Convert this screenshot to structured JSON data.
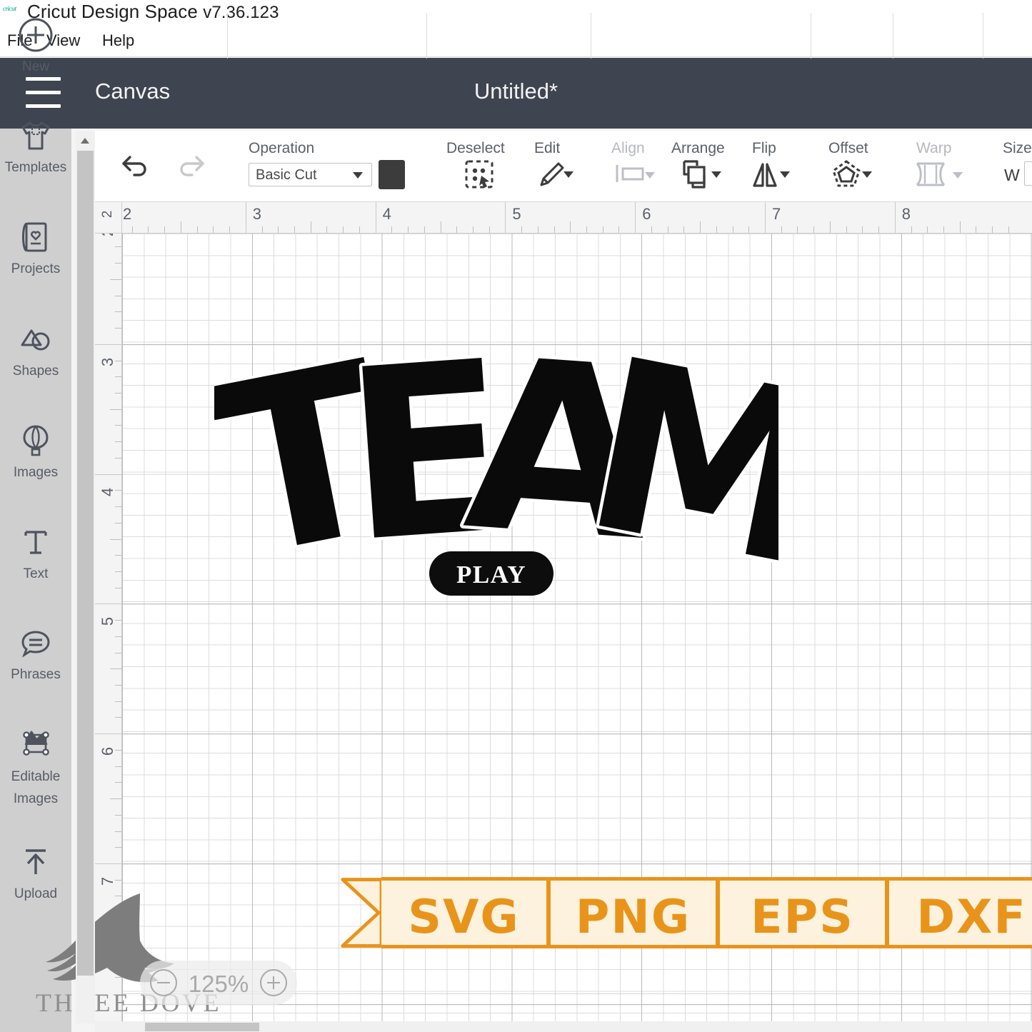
{
  "titlebar": {
    "logo": "cricut",
    "app_name": "Cricut Design Space",
    "version": "v7.36.123"
  },
  "menubar": {
    "items": [
      {
        "label": "File"
      },
      {
        "label": "View"
      },
      {
        "label": "Help"
      }
    ]
  },
  "header": {
    "menu_icon": "hamburger-icon",
    "canvas_label": "Canvas",
    "document_title": "Untitled*"
  },
  "sidebar": {
    "items": [
      {
        "label": "New",
        "icon": "plus-circle-icon"
      },
      {
        "label": "Templates",
        "icon": "tshirt-icon"
      },
      {
        "label": "Projects",
        "icon": "card-heart-icon"
      },
      {
        "label": "Shapes",
        "icon": "triangle-circle-icon"
      },
      {
        "label": "Images",
        "icon": "hot-air-balloon-icon"
      },
      {
        "label": "Text",
        "icon": "text-t-icon"
      },
      {
        "label": "Phrases",
        "icon": "speech-bubble-icon"
      },
      {
        "label": "Editable Images",
        "icon": "node-path-icon"
      },
      {
        "label": "Upload",
        "icon": "upload-arrow-icon"
      }
    ]
  },
  "toolbar": {
    "undo_label": "undo-icon",
    "redo_label": "redo-icon",
    "operation_label": "Operation",
    "operation_value": "Basic Cut",
    "color_swatch": "#3c3c3c",
    "groups": [
      {
        "label": "Deselect",
        "icon": "deselect-icon",
        "disabled": false,
        "has_caret": false
      },
      {
        "label": "Edit",
        "icon": "pencil-icon",
        "disabled": false,
        "has_caret": true
      },
      {
        "label": "Align",
        "icon": "align-icon",
        "disabled": true,
        "has_caret": true
      },
      {
        "label": "Arrange",
        "icon": "arrange-icon",
        "disabled": false,
        "has_caret": true
      },
      {
        "label": "Flip",
        "icon": "flip-icon",
        "disabled": false,
        "has_caret": true
      },
      {
        "label": "Offset",
        "icon": "offset-icon",
        "disabled": false,
        "has_caret": true
      },
      {
        "label": "Warp",
        "icon": "warp-icon",
        "disabled": true,
        "has_caret": true
      },
      {
        "label": "Size",
        "icon": "size-icon",
        "disabled": false,
        "has_caret": false
      }
    ],
    "size_w_label": "W"
  },
  "rulers": {
    "horizontal_ticks": [
      "2",
      "3",
      "4",
      "5",
      "6",
      "7",
      "8"
    ],
    "vertical_ticks": [
      "2",
      "3",
      "4",
      "5",
      "6",
      "7"
    ],
    "corner_tick": "2"
  },
  "artwork": {
    "word": "TEAM",
    "letters": [
      "T",
      "E",
      "A",
      "M"
    ],
    "badge_text": "PLAY",
    "fill_color": "#0a0a0a",
    "stroke_color": "#ffffff"
  },
  "banner": {
    "formats": [
      "SVG",
      "PNG",
      "EPS",
      "DXF"
    ],
    "accent_color": "#e8941b",
    "fill_color": "#fdf2dd"
  },
  "watermark": {
    "brand": "THREE DOVE",
    "icon": "dove-icon"
  },
  "zoom_control": {
    "value": "125%",
    "minus_icon": "minus-circle-icon",
    "plus_icon": "plus-circle-icon"
  }
}
